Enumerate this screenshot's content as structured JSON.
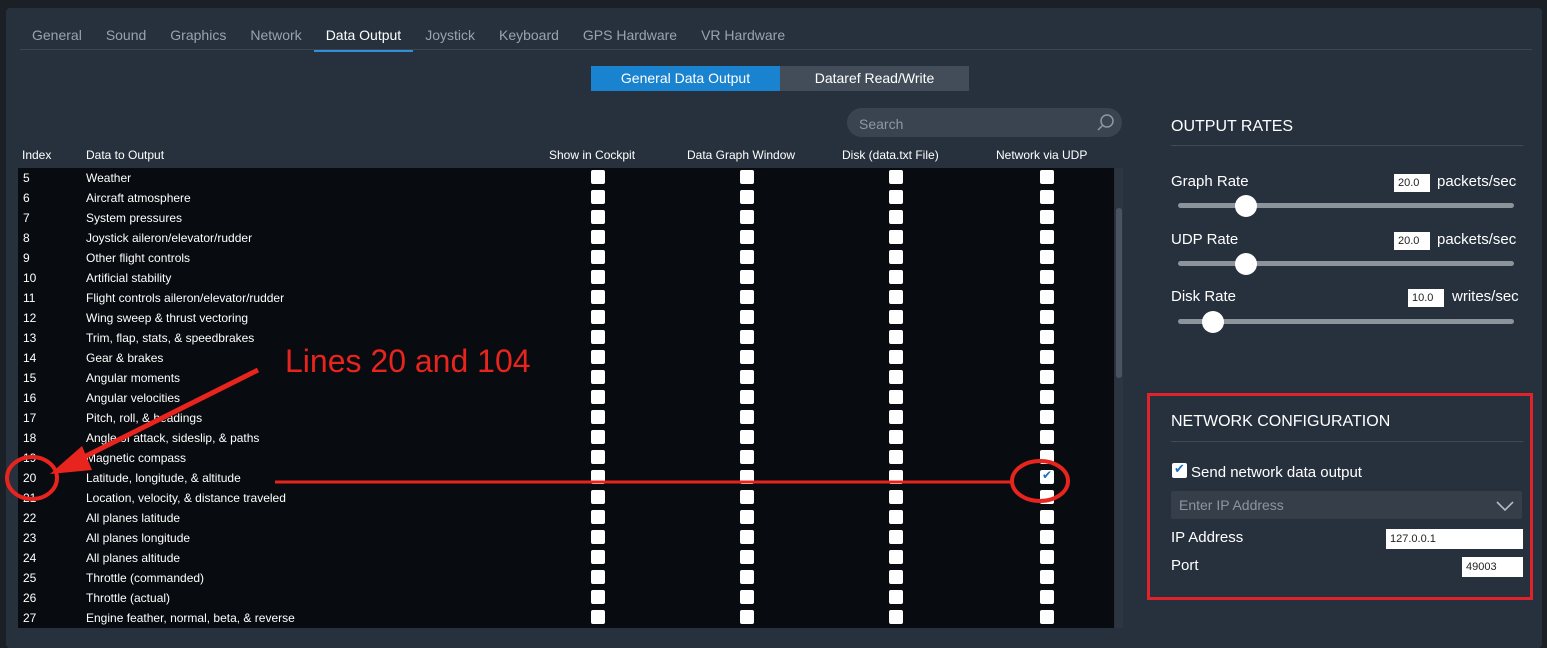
{
  "tabs": [
    {
      "label": "General"
    },
    {
      "label": "Sound"
    },
    {
      "label": "Graphics"
    },
    {
      "label": "Network"
    },
    {
      "label": "Data Output"
    },
    {
      "label": "Joystick"
    },
    {
      "label": "Keyboard"
    },
    {
      "label": "GPS Hardware"
    },
    {
      "label": "VR Hardware"
    }
  ],
  "active_tab": "Data Output",
  "segmented": {
    "left": "General Data Output",
    "right": "Dataref Read/Write"
  },
  "search": {
    "placeholder": "Search"
  },
  "table": {
    "headers": {
      "index": "Index",
      "data": "Data to Output",
      "cockpit": "Show in Cockpit",
      "graph": "Data Graph Window",
      "disk": "Disk (data.txt File)",
      "udp": "Network via UDP"
    },
    "rows": [
      {
        "index": "5",
        "name": "Weather"
      },
      {
        "index": "6",
        "name": "Aircraft atmosphere"
      },
      {
        "index": "7",
        "name": "System pressures"
      },
      {
        "index": "8",
        "name": "Joystick aileron/elevator/rudder"
      },
      {
        "index": "9",
        "name": "Other flight controls"
      },
      {
        "index": "10",
        "name": "Artificial stability"
      },
      {
        "index": "11",
        "name": "Flight controls aileron/elevator/rudder"
      },
      {
        "index": "12",
        "name": "Wing sweep & thrust vectoring"
      },
      {
        "index": "13",
        "name": "Trim, flap, stats, & speedbrakes"
      },
      {
        "index": "14",
        "name": "Gear & brakes"
      },
      {
        "index": "15",
        "name": "Angular moments"
      },
      {
        "index": "16",
        "name": "Angular velocities"
      },
      {
        "index": "17",
        "name": "Pitch, roll, & headings"
      },
      {
        "index": "18",
        "name": "Angle of attack, sideslip, & paths"
      },
      {
        "index": "19",
        "name": "Magnetic compass"
      },
      {
        "index": "20",
        "name": "Latitude, longitude, & altitude"
      },
      {
        "index": "21",
        "name": "Location, velocity, & distance traveled"
      },
      {
        "index": "22",
        "name": "All planes latitude"
      },
      {
        "index": "23",
        "name": "All planes longitude"
      },
      {
        "index": "24",
        "name": "All planes altitude"
      },
      {
        "index": "25",
        "name": "Throttle (commanded)"
      },
      {
        "index": "26",
        "name": "Throttle (actual)"
      },
      {
        "index": "27",
        "name": "Engine feather, normal, beta, & reverse"
      }
    ],
    "udp_checked_index": "20"
  },
  "output_rates": {
    "title": "OUTPUT RATES",
    "graph": {
      "label": "Graph Rate",
      "value": "20.0",
      "unit": "packets/sec"
    },
    "udp": {
      "label": "UDP Rate",
      "value": "20.0",
      "unit": "packets/sec"
    },
    "disk": {
      "label": "Disk Rate",
      "value": "10.0",
      "unit": "writes/sec"
    }
  },
  "network_config": {
    "title": "NETWORK CONFIGURATION",
    "send_label": "Send network data output",
    "dropdown_text": "Enter IP Address",
    "ip_label": "IP Address",
    "ip_value": "127.0.0.1",
    "port_label": "Port",
    "port_value": "49003"
  },
  "annotation": {
    "text": "Lines 20 and 104"
  },
  "colors": {
    "accent": "#1a83d0",
    "annotation": "#e8241e"
  }
}
